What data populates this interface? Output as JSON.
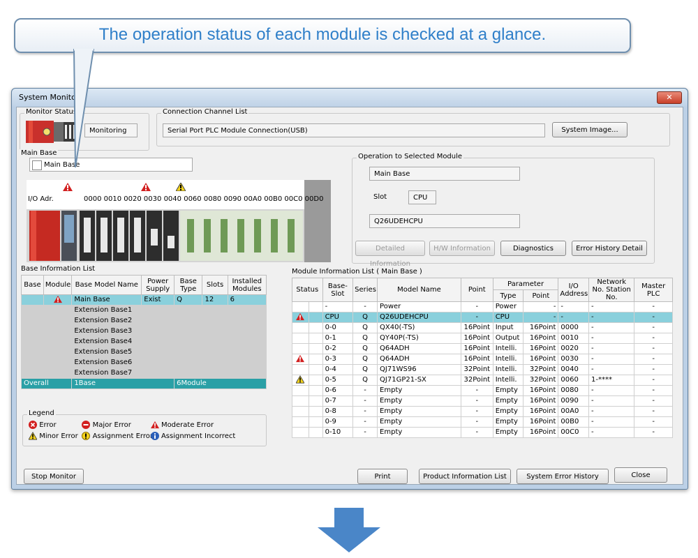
{
  "callout": {
    "text": "The operation status of each module is checked at a glance."
  },
  "window": {
    "title": "System Monitor",
    "close": "✕"
  },
  "monitor_status": {
    "group": "Monitor Status",
    "state": "Monitoring"
  },
  "connection": {
    "group": "Connection Channel List",
    "value": "Serial Port  PLC Module Connection(USB)",
    "system_image": "System Image..."
  },
  "main_base": {
    "group": "Main Base",
    "name": "Main Base",
    "io_label": "I/O Adr.",
    "io_addresses": [
      "0000",
      "0010",
      "0020",
      "0030",
      "0040",
      "0060",
      "0080",
      "0090",
      "00A0",
      "00B0",
      "00C0",
      "00D0"
    ]
  },
  "operation": {
    "group": "Operation to Selected Module",
    "base": "Main Base",
    "slot_label": "Slot",
    "slot_value": "CPU",
    "model": "Q26UDEHCPU",
    "buttons": [
      "Detailed Information",
      "H/W Information",
      "Diagnostics",
      "Error History Detail"
    ]
  },
  "base_info": {
    "group": "Base Information List",
    "headers": [
      "Base",
      "Module",
      "Base Model Name",
      "Power Supply",
      "Base Type",
      "Slots",
      "Installed Modules"
    ],
    "rows": [
      {
        "module": "warn",
        "name": "Main Base",
        "power": "Exist",
        "type": "Q",
        "slots": "12",
        "installed": "6",
        "style": "sel"
      },
      {
        "module": "",
        "name": "Extension Base1",
        "power": "",
        "type": "",
        "slots": "",
        "installed": "",
        "style": "gray"
      },
      {
        "module": "",
        "name": "Extension Base2",
        "power": "",
        "type": "",
        "slots": "",
        "installed": "",
        "style": "gray"
      },
      {
        "module": "",
        "name": "Extension Base3",
        "power": "",
        "type": "",
        "slots": "",
        "installed": "",
        "style": "gray"
      },
      {
        "module": "",
        "name": "Extension Base4",
        "power": "",
        "type": "",
        "slots": "",
        "installed": "",
        "style": "gray"
      },
      {
        "module": "",
        "name": "Extension Base5",
        "power": "",
        "type": "",
        "slots": "",
        "installed": "",
        "style": "gray"
      },
      {
        "module": "",
        "name": "Extension Base6",
        "power": "",
        "type": "",
        "slots": "",
        "installed": "",
        "style": "gray"
      },
      {
        "module": "",
        "name": "Extension Base7",
        "power": "",
        "type": "",
        "slots": "",
        "installed": "",
        "style": "gray"
      }
    ],
    "total": {
      "base": "Overall",
      "name": "1Base",
      "type": "6Module"
    }
  },
  "legend": {
    "group": "Legend",
    "items": [
      {
        "icon": "error-icon",
        "label": "Error"
      },
      {
        "icon": "major-error-icon",
        "label": "Major Error"
      },
      {
        "icon": "moderate-error-icon",
        "label": "Moderate Error"
      },
      {
        "icon": "minor-error-icon",
        "label": "Minor Error"
      },
      {
        "icon": "assignment-error-icon",
        "label": "Assignment Error"
      },
      {
        "icon": "assignment-incorrect-icon",
        "label": "Assignment Incorrect"
      }
    ]
  },
  "module_info": {
    "group": "Module Information List ( Main Base )",
    "headers": {
      "status": "Status",
      "slot": "Base-Slot",
      "series": "Series",
      "model": "Model Name",
      "point": "Point",
      "parameter": "Parameter",
      "ptype": "Type",
      "ppoint": "Point",
      "io": "I/O Address",
      "network": "Network No. Station No.",
      "master": "Master PLC"
    },
    "rows": [
      {
        "status": "",
        "slot": "-",
        "series": "-",
        "model": "Power",
        "point": "-",
        "type": "Power",
        "ppoint": "-",
        "io": "-",
        "network": "-",
        "master": "-",
        "style": ""
      },
      {
        "status": "moderate",
        "slot": "CPU",
        "series": "Q",
        "model": "Q26UDEHCPU",
        "point": "-",
        "type": "CPU",
        "ppoint": "-",
        "io": "-",
        "network": "-",
        "master": "-",
        "style": "sel"
      },
      {
        "status": "",
        "slot": "0-0",
        "series": "Q",
        "model": "QX40(-TS)",
        "point": "16Point",
        "type": "Input",
        "ppoint": "16Point",
        "io": "0000",
        "network": "-",
        "master": "-",
        "style": ""
      },
      {
        "status": "",
        "slot": "0-1",
        "series": "Q",
        "model": "QY40P(-TS)",
        "point": "16Point",
        "type": "Output",
        "ppoint": "16Point",
        "io": "0010",
        "network": "-",
        "master": "-",
        "style": ""
      },
      {
        "status": "",
        "slot": "0-2",
        "series": "Q",
        "model": "Q64ADH",
        "point": "16Point",
        "type": "Intelli.",
        "ppoint": "16Point",
        "io": "0020",
        "network": "-",
        "master": "-",
        "style": ""
      },
      {
        "status": "moderate",
        "slot": "0-3",
        "series": "Q",
        "model": "Q64ADH",
        "point": "16Point",
        "type": "Intelli.",
        "ppoint": "16Point",
        "io": "0030",
        "network": "-",
        "master": "-",
        "style": ""
      },
      {
        "status": "",
        "slot": "0-4",
        "series": "Q",
        "model": "QJ71WS96",
        "point": "32Point",
        "type": "Intelli.",
        "ppoint": "32Point",
        "io": "0040",
        "network": "-",
        "master": "-",
        "style": ""
      },
      {
        "status": "minor",
        "slot": "0-5",
        "series": "Q",
        "model": "QJ71GP21-SX",
        "point": "32Point",
        "type": "Intelli.",
        "ppoint": "32Point",
        "io": "0060",
        "network": "1-****",
        "master": "-",
        "style": ""
      },
      {
        "status": "",
        "slot": "0-6",
        "series": "-",
        "model": "Empty",
        "point": "-",
        "type": "Empty",
        "ppoint": "16Point",
        "io": "0080",
        "network": "-",
        "master": "-",
        "style": ""
      },
      {
        "status": "",
        "slot": "0-7",
        "series": "-",
        "model": "Empty",
        "point": "-",
        "type": "Empty",
        "ppoint": "16Point",
        "io": "0090",
        "network": "-",
        "master": "-",
        "style": ""
      },
      {
        "status": "",
        "slot": "0-8",
        "series": "-",
        "model": "Empty",
        "point": "-",
        "type": "Empty",
        "ppoint": "16Point",
        "io": "00A0",
        "network": "-",
        "master": "-",
        "style": ""
      },
      {
        "status": "",
        "slot": "0-9",
        "series": "-",
        "model": "Empty",
        "point": "-",
        "type": "Empty",
        "ppoint": "16Point",
        "io": "00B0",
        "network": "-",
        "master": "-",
        "style": ""
      },
      {
        "status": "",
        "slot": "0-10",
        "series": "-",
        "model": "Empty",
        "point": "-",
        "type": "Empty",
        "ppoint": "16Point",
        "io": "00C0",
        "network": "-",
        "master": "-",
        "style": ""
      }
    ]
  },
  "footer": {
    "stop_monitor": "Stop Monitor",
    "print": "Print",
    "product_info": "Product Information List",
    "system_error_history": "System Error History",
    "close": "Close"
  },
  "colors": {
    "callout_text": "#2f7fc9",
    "selected_row": "#8ad0dc",
    "total_row": "#2aa0a6",
    "arrow": "#4a86c8"
  }
}
